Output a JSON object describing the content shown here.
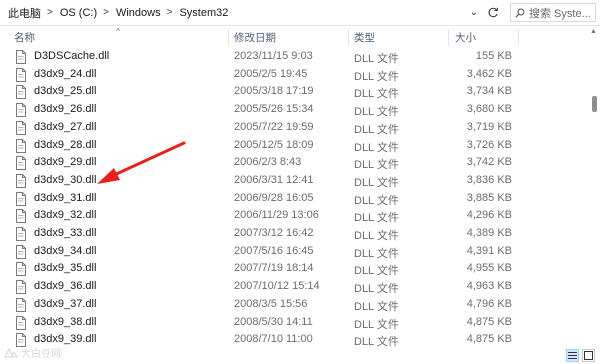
{
  "address": {
    "breadcrumbs": [
      "此电脑",
      "OS (C:)",
      "Windows",
      "System32"
    ],
    "separator": ">",
    "dropdown": "⌄",
    "refresh_icon": "refresh-icon"
  },
  "search": {
    "placeholder": "搜索 Syste...",
    "display": "Syste..."
  },
  "columns": {
    "name": "名称",
    "modified": "修改日期",
    "type": "类型",
    "size": "大小",
    "sort_glyph": "^"
  },
  "files": [
    {
      "name": "D3DSCache.dll",
      "modified": "2023/11/15 9:03",
      "type": "DLL 文件",
      "size": "155 KB"
    },
    {
      "name": "d3dx9_24.dll",
      "modified": "2005/2/5 19:45",
      "type": "DLL 文件",
      "size": "3,462 KB"
    },
    {
      "name": "d3dx9_25.dll",
      "modified": "2005/3/18 17:19",
      "type": "DLL 文件",
      "size": "3,734 KB"
    },
    {
      "name": "d3dx9_26.dll",
      "modified": "2005/5/26 15:34",
      "type": "DLL 文件",
      "size": "3,680 KB"
    },
    {
      "name": "d3dx9_27.dll",
      "modified": "2005/7/22 19:59",
      "type": "DLL 文件",
      "size": "3,719 KB"
    },
    {
      "name": "d3dx9_28.dll",
      "modified": "2005/12/5 18:09",
      "type": "DLL 文件",
      "size": "3,726 KB"
    },
    {
      "name": "d3dx9_29.dll",
      "modified": "2006/2/3 8:43",
      "type": "DLL 文件",
      "size": "3,742 KB"
    },
    {
      "name": "d3dx9_30.dll",
      "modified": "2006/3/31 12:41",
      "type": "DLL 文件",
      "size": "3,836 KB"
    },
    {
      "name": "d3dx9_31.dll",
      "modified": "2006/9/28 16:05",
      "type": "DLL 文件",
      "size": "3,885 KB"
    },
    {
      "name": "d3dx9_32.dll",
      "modified": "2006/11/29 13:06",
      "type": "DLL 文件",
      "size": "4,296 KB"
    },
    {
      "name": "d3dx9_33.dll",
      "modified": "2007/3/12 16:42",
      "type": "DLL 文件",
      "size": "4,389 KB"
    },
    {
      "name": "d3dx9_34.dll",
      "modified": "2007/5/16 16:45",
      "type": "DLL 文件",
      "size": "4,391 KB"
    },
    {
      "name": "d3dx9_35.dll",
      "modified": "2007/7/19 18:14",
      "type": "DLL 文件",
      "size": "4,955 KB"
    },
    {
      "name": "d3dx9_36.dll",
      "modified": "2007/10/12 15:14",
      "type": "DLL 文件",
      "size": "4,963 KB"
    },
    {
      "name": "d3dx9_37.dll",
      "modified": "2008/3/5 15:56",
      "type": "DLL 文件",
      "size": "4,796 KB"
    },
    {
      "name": "d3dx9_38.dll",
      "modified": "2008/5/30 14:11",
      "type": "DLL 文件",
      "size": "4,875 KB"
    },
    {
      "name": "d3dx9_39.dll",
      "modified": "2008/7/10 11:00",
      "type": "DLL 文件",
      "size": "4,875 KB"
    }
  ],
  "annotation": {
    "color": "#e8201d",
    "target_file": "d3dx9_30.dll"
  },
  "watermark": {
    "text": "大白豆网"
  },
  "colors": {
    "header_text": "#4c607a",
    "selected_view": "#cce8ff",
    "address_text": "#1a1a1a"
  }
}
